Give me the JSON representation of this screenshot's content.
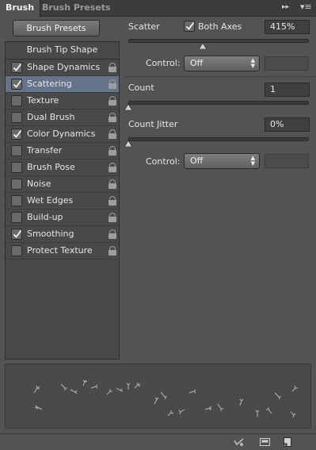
{
  "tabs": [
    {
      "label": "Brush",
      "active": true
    },
    {
      "label": "Brush Presets",
      "active": false
    }
  ],
  "icons": {
    "panel_menu": "panel-menu-icon",
    "collapse": "collapse-arrows-icon"
  },
  "presets_button": "Brush Presets",
  "tip_shape": "Brush Tip Shape",
  "options": [
    {
      "label": "Shape Dynamics",
      "checked": true,
      "selected": false
    },
    {
      "label": "Scattering",
      "checked": true,
      "selected": true
    },
    {
      "label": "Texture",
      "checked": false,
      "selected": false
    },
    {
      "label": "Dual Brush",
      "checked": false,
      "selected": false
    },
    {
      "label": "Color Dynamics",
      "checked": true,
      "selected": false
    },
    {
      "label": "Transfer",
      "checked": false,
      "selected": false
    },
    {
      "label": "Brush Pose",
      "checked": false,
      "selected": false
    },
    {
      "label": "Noise",
      "checked": false,
      "selected": false
    },
    {
      "label": "Wet Edges",
      "checked": false,
      "selected": false
    },
    {
      "label": "Build-up",
      "checked": false,
      "selected": false
    },
    {
      "label": "Smoothing",
      "checked": true,
      "selected": false
    },
    {
      "label": "Protect Texture",
      "checked": false,
      "selected": false
    }
  ],
  "scatter": {
    "label": "Scatter",
    "both_axes_label": "Both Axes",
    "both_axes_checked": true,
    "value": "415%",
    "slider_fraction": 0.415,
    "control_label": "Control:",
    "control_value": "Off"
  },
  "count": {
    "label": "Count",
    "value": "1",
    "slider_fraction": 0.0
  },
  "count_jitter": {
    "label": "Count Jitter",
    "value": "0%",
    "slider_fraction": 0.0,
    "control_label": "Control:",
    "control_value": "Off"
  },
  "colors": {
    "panel": "#535353",
    "selection": "#65748a",
    "field": "#3f3f3f"
  }
}
